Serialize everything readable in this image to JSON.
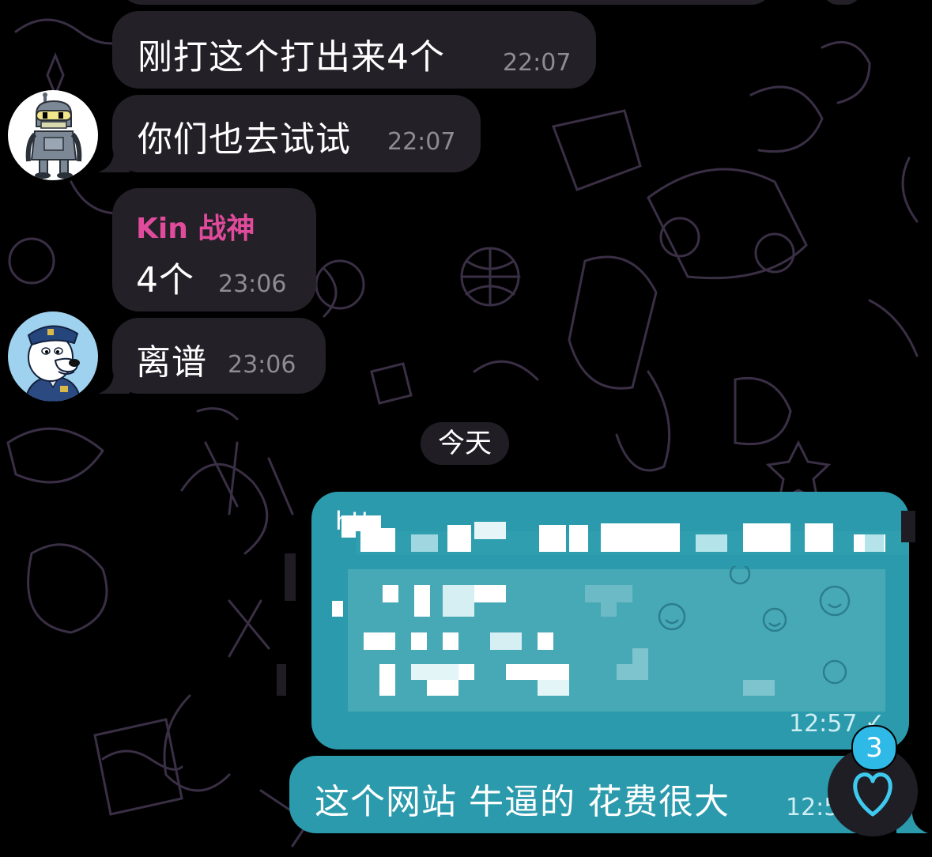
{
  "messages": [
    {
      "text": "刚打这个打出来4个",
      "time": "22:07"
    },
    {
      "text": "你们也去试试",
      "time": "22:07"
    },
    {
      "sender": "Kin 战神",
      "text": "4个",
      "time": "23:06"
    },
    {
      "text": "离谱",
      "time": "23:06"
    }
  ],
  "date_separator": "今天",
  "outgoing": [
    {
      "text_fragment": "htt",
      "time": "12:57",
      "status": "✓"
    },
    {
      "text": "这个网站 牛逼的 花费很大",
      "time": "12:5"
    }
  ],
  "reaction_badge_count": "3",
  "icons": [
    "bender-avatar",
    "dog-police-avatar",
    "heart-icon",
    "checkmark-icon"
  ],
  "colors": {
    "background": "#000000",
    "incoming_bubble": "#232027",
    "outgoing_bubble": "#2a9aac",
    "sender_name": "#e04b9b",
    "badge": "#2fb9e6",
    "doodle": "#3a2f45"
  }
}
